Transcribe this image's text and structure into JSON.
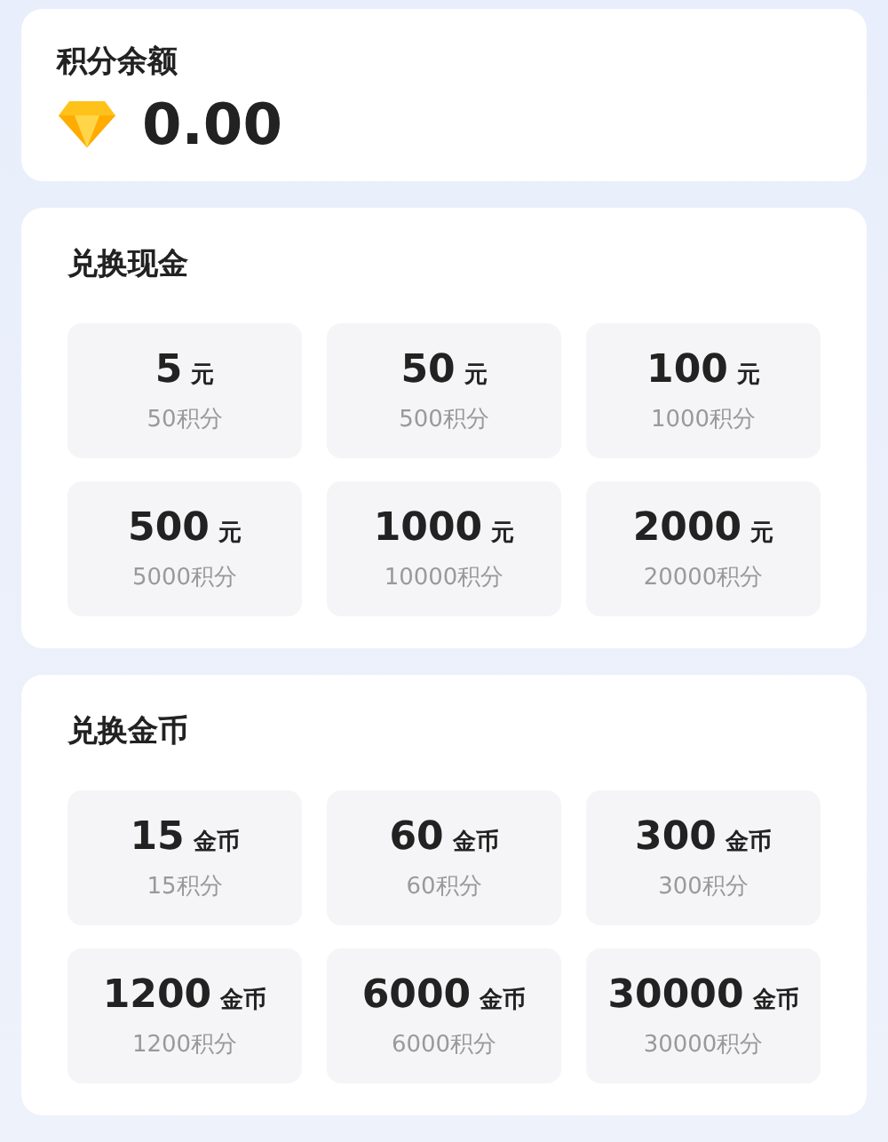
{
  "balance": {
    "title": "积分余额",
    "amount": "0.00"
  },
  "sections": [
    {
      "title": "兑换现金",
      "items": [
        {
          "value": "5",
          "unit": "元",
          "cost": "50积分"
        },
        {
          "value": "50",
          "unit": "元",
          "cost": "500积分"
        },
        {
          "value": "100",
          "unit": "元",
          "cost": "1000积分"
        },
        {
          "value": "500",
          "unit": "元",
          "cost": "5000积分"
        },
        {
          "value": "1000",
          "unit": "元",
          "cost": "10000积分"
        },
        {
          "value": "2000",
          "unit": "元",
          "cost": "20000积分"
        }
      ]
    },
    {
      "title": "兑换金币",
      "items": [
        {
          "value": "15",
          "unit": "金币",
          "cost": "15积分"
        },
        {
          "value": "60",
          "unit": "金币",
          "cost": "60积分"
        },
        {
          "value": "300",
          "unit": "金币",
          "cost": "300积分"
        },
        {
          "value": "1200",
          "unit": "金币",
          "cost": "1200积分"
        },
        {
          "value": "6000",
          "unit": "金币",
          "cost": "6000积分"
        },
        {
          "value": "30000",
          "unit": "金币",
          "cost": "30000积分"
        }
      ]
    }
  ]
}
